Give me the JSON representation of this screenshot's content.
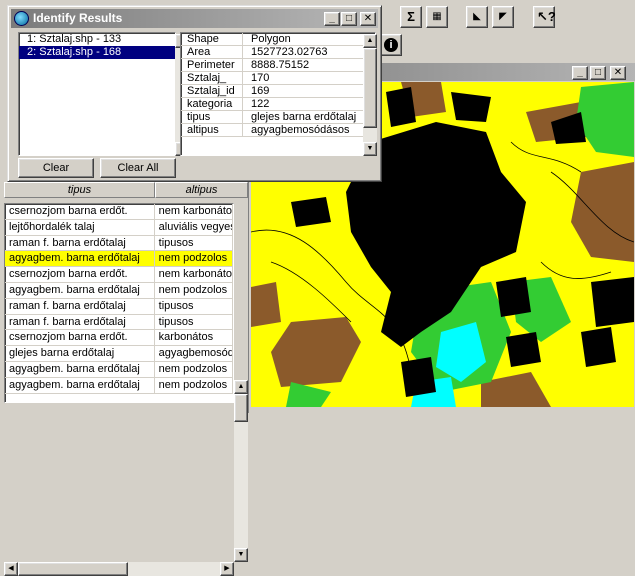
{
  "identify": {
    "title": "Identify Results",
    "features": [
      {
        "index": "1:",
        "label": "Sztalaj.shp - 133"
      },
      {
        "index": "2:",
        "label": "Sztalaj.shp - 168"
      }
    ],
    "selected_feature": 1,
    "attributes": [
      {
        "key": "Shape",
        "value": "Polygon"
      },
      {
        "key": "Area",
        "value": "1527723.02763"
      },
      {
        "key": "Perimeter",
        "value": "8888.75152"
      },
      {
        "key": "Sztalaj_",
        "value": "170"
      },
      {
        "key": "Sztalaj_id",
        "value": "169"
      },
      {
        "key": "kategoria",
        "value": "122"
      },
      {
        "key": "tipus",
        "value": "glejes barna erdőtalaj"
      },
      {
        "key": "altipus",
        "value": "agyagbemosódásos"
      }
    ],
    "clear_label": "Clear",
    "clear_all_label": "Clear All"
  },
  "table": {
    "columns": [
      "tipus",
      "altipus"
    ],
    "rows": [
      [
        "csernozjom barna erdőt.",
        "nem karbonátos"
      ],
      [
        "lejtőhordalék talaj",
        "aluviális vegyes"
      ],
      [
        "raman f. barna erdőtalaj",
        "tipusos"
      ],
      [
        "agyagbem. barna erdőtalaj",
        "nem podzolos"
      ],
      [
        "csernozjom barna erdőt.",
        "nem karbonátos"
      ],
      [
        "agyagbem. barna erdőtalaj",
        "nem podzolos"
      ],
      [
        "raman f. barna erdőtalaj",
        "tipusos"
      ],
      [
        "raman f. barna erdőtalaj",
        "tipusos"
      ],
      [
        "csernozjom barna erdőt.",
        "karbonátos"
      ],
      [
        "glejes barna erdőtalaj",
        "agyagbemosódásos"
      ],
      [
        "agyagbem. barna erdőtalaj",
        "nem podzolos"
      ],
      [
        "agyagbem. barna erdőtalaj",
        "nem podzolos"
      ]
    ],
    "selected_row": 3
  },
  "colors": {
    "selection": "#000080",
    "highlight_row": "#ffff00",
    "map_yellow": "#ffff00",
    "map_black": "#000000",
    "map_brown": "#8b5a2b",
    "map_green": "#33cc33",
    "map_cyan": "#00ffff"
  }
}
